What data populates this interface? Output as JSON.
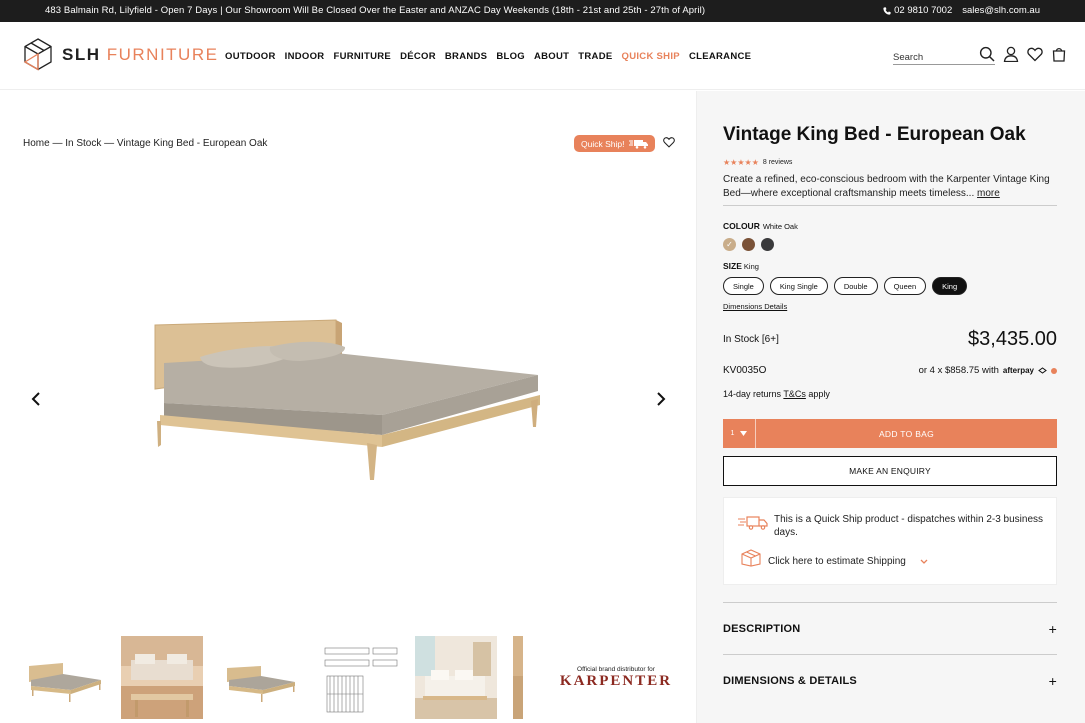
{
  "announcement": {
    "message": "483 Balmain Rd, Lilyfield - Open 7 Days | Our Showroom Will Be Closed Over the Easter and ANZAC Day Weekends (18th - 21st and 25th - 27th of April)",
    "phone": "02 9810 7002",
    "email": "sales@slh.com.au"
  },
  "logo": {
    "part1": "SLH",
    "part2": "FURNITURE"
  },
  "nav": [
    {
      "label": "OUTDOOR"
    },
    {
      "label": "INDOOR"
    },
    {
      "label": "FURNITURE"
    },
    {
      "label": "DÉCOR"
    },
    {
      "label": "BRANDS"
    },
    {
      "label": "BLOG"
    },
    {
      "label": "ABOUT"
    },
    {
      "label": "TRADE"
    },
    {
      "label": "QUICK SHIP"
    },
    {
      "label": "CLEARANCE"
    }
  ],
  "search": {
    "placeholder": "Search"
  },
  "breadcrumb": "Home — In Stock — Vintage King Bed - European Oak",
  "quickship_pill": "Quick Ship!",
  "brand_badge": {
    "caption": "Official brand distributor for",
    "name": "KARPENTER"
  },
  "product": {
    "title": "Vintage King Bed - European Oak",
    "stars": "★★★★★",
    "reviews": "8 reviews",
    "description": "Create a refined, eco-conscious bedroom with the Karpenter Vintage King Bed—where exceptional craftsmanship meets timeless...",
    "more": "more",
    "colour_label": "COLOUR",
    "colour_value": "White Oak",
    "swatch_check": "✓",
    "swatches": [
      "#c9ad8a",
      "#7a5238",
      "#3a3a3c"
    ],
    "size_label": "SIZE",
    "size_value": "King",
    "sizes": [
      {
        "label": "Single"
      },
      {
        "label": "King Single"
      },
      {
        "label": "Double"
      },
      {
        "label": "Queen"
      },
      {
        "label": "King"
      }
    ],
    "dimensions_link": "Dimensions Details",
    "stock": "In Stock [6+]",
    "price": "$3,435.00",
    "sku": "KV0035O",
    "afterpay_text": "or 4 x $858.75 with",
    "afterpay_logo": "afterpay",
    "returns_prefix": "14-day returns",
    "returns_link": "T&Cs",
    "returns_suffix": "apply",
    "qty": "1",
    "add_to_bag": "ADD TO BAG",
    "enquiry": "MAKE AN ENQUIRY",
    "ship_message": "This is a Quick Ship product - dispatches within 2-3 business days.",
    "estimate_shipping": "Click here to estimate Shipping",
    "accordion": [
      {
        "label": "DESCRIPTION"
      },
      {
        "label": "DIMENSIONS & DETAILS"
      }
    ],
    "accent": "#e8825b"
  }
}
